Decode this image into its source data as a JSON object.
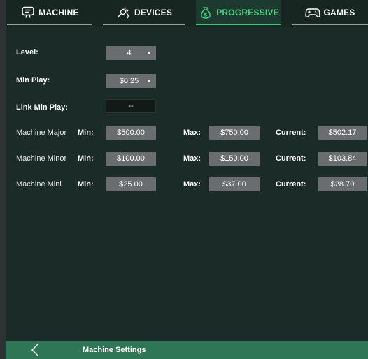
{
  "tabs": [
    {
      "label": "MACHINE",
      "icon": "machine-icon",
      "active": false
    },
    {
      "label": "DEVICES",
      "icon": "devices-icon",
      "active": false
    },
    {
      "label": "PROGRESSIVE",
      "icon": "money-bag-icon",
      "active": true
    },
    {
      "label": "GAMES",
      "icon": "gamepad-icon",
      "active": false
    }
  ],
  "settings": {
    "level_label": "Level:",
    "level_value": "4",
    "min_play_label": "Min Play:",
    "min_play_value": "$0.25",
    "link_min_play_label": "Link Min Play:",
    "link_min_play_value": "--"
  },
  "progressives": [
    {
      "name": "Machine Major",
      "min_label": "Min:",
      "min": "$500.00",
      "max_label": "Max:",
      "max": "$750.00",
      "current_label": "Current:",
      "current": "$502.17"
    },
    {
      "name": "Machine Minor",
      "min_label": "Min:",
      "min": "$100.00",
      "max_label": "Max:",
      "max": "$150.00",
      "current_label": "Current:",
      "current": "$103.84"
    },
    {
      "name": "Machine Mini",
      "min_label": "Min:",
      "min": "$25.00",
      "max_label": "Max:",
      "max": "$37.00",
      "current_label": "Current:",
      "current": "$28.70"
    }
  ],
  "footer": {
    "title": "Machine Settings",
    "back_icon": "chevron-left-icon"
  },
  "colors": {
    "accent": "#34c978",
    "footer": "#2f7656",
    "background": "#1b2b27",
    "field": "#6a6d6f"
  }
}
